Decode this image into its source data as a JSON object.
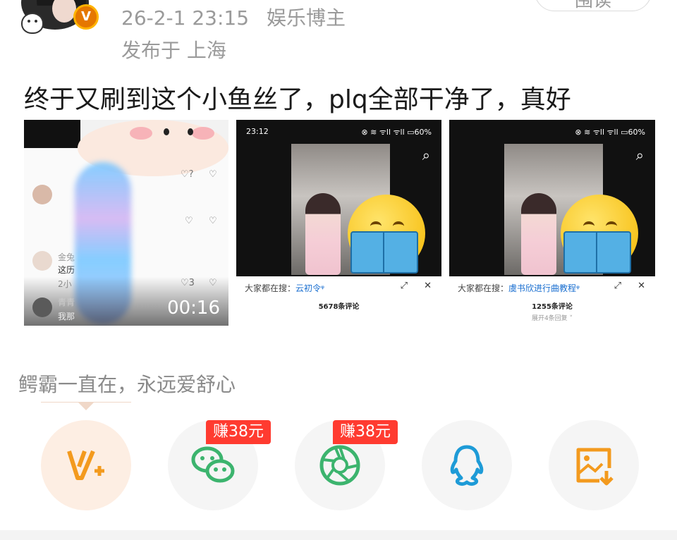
{
  "header": {
    "date": "26-2-1 23:15",
    "category": "娱乐博主",
    "location": "发布于 上海",
    "follow_label": "围读",
    "badge_letter": "V"
  },
  "post": {
    "text": "终于又刷到这个小鱼丝了，plq全部干净了，真好"
  },
  "images": [
    {
      "type": "video",
      "duration": "00:16",
      "comments": [
        {
          "like": "♡?",
          "text": ""
        },
        {
          "like": "♡",
          "text": "这历"
        },
        {
          "like": "♡3",
          "text": "我那"
        }
      ],
      "names": [
        "金兔",
        "青青"
      ],
      "time_hint": "2小"
    },
    {
      "type": "screenshot",
      "status_time": "23:12",
      "status_icons": "⊗ ≋ ᯤll ᯤll ▭60%",
      "search_prefix": "大家都在搜：",
      "search_term": "云初令",
      "comments_count": "5678条评论",
      "more": ""
    },
    {
      "type": "screenshot",
      "status_time": "",
      "status_icons": "⊗ ≋ ᯤll ᯤll ▭60%",
      "search_prefix": "大家都在搜：",
      "search_term": "虞书欣进行曲教程",
      "comments_count": "1255条评论",
      "more": "展开4条回复 ˅"
    }
  ],
  "caption": "鳄霸一直在，永远爱舒心",
  "share": {
    "reward_1": "赚38元",
    "reward_2": "赚38元",
    "items": [
      "weibo-vplus",
      "wechat",
      "moments",
      "qq",
      "save-image"
    ]
  },
  "colors": {
    "accent_orange": "#f39a1e",
    "wechat_green": "#3cb46e",
    "qq_blue": "#1e9bd7",
    "reward_red": "#ff3b30"
  }
}
